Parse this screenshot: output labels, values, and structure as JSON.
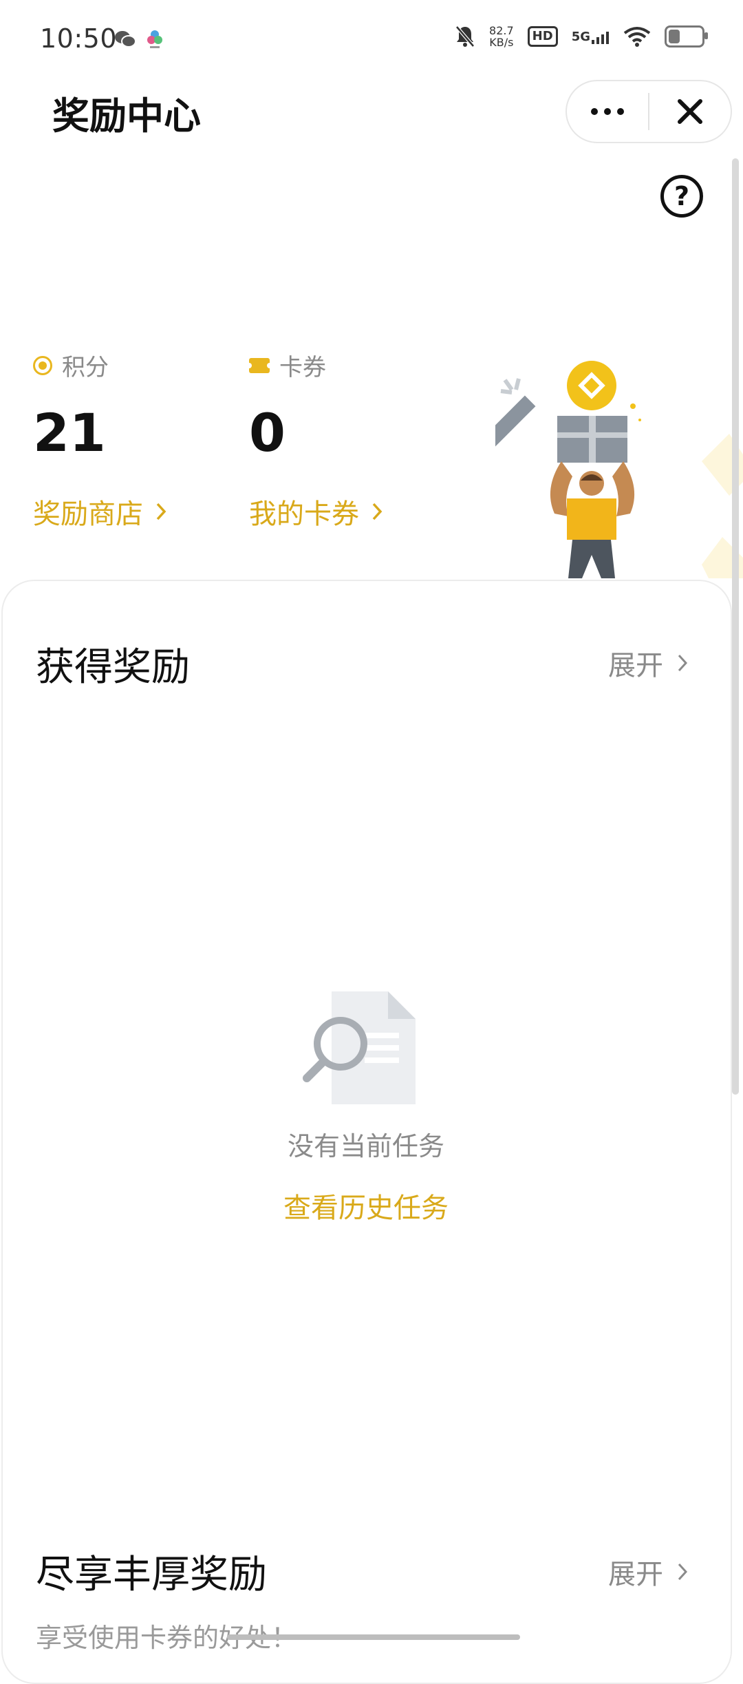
{
  "status_bar": {
    "time": "10:50",
    "net_speed_value": "82.7",
    "net_speed_unit": "KB/s",
    "hd": "HD",
    "network": "5G",
    "battery_level": 0.35
  },
  "header": {
    "title": "奖励中心",
    "more_icon": "more-dots-icon",
    "close_icon": "close-icon"
  },
  "stats": {
    "points": {
      "label": "积分",
      "value": "21",
      "link": "奖励商店",
      "icon": "coin-icon"
    },
    "coupons": {
      "label": "卡券",
      "value": "0",
      "link": "我的卡券",
      "icon": "ticket-icon"
    }
  },
  "rewards_section": {
    "title": "获得奖励",
    "expand": "展开",
    "empty_text": "没有当前任务",
    "history_link": "查看历史任务"
  },
  "enjoy_section": {
    "title": "尽享丰厚奖励",
    "expand": "展开",
    "subtitle": "享受使用卡券的好处！"
  },
  "colors": {
    "accent": "#d9a91a",
    "text_primary": "#111111",
    "text_secondary": "#8a8a8a"
  }
}
